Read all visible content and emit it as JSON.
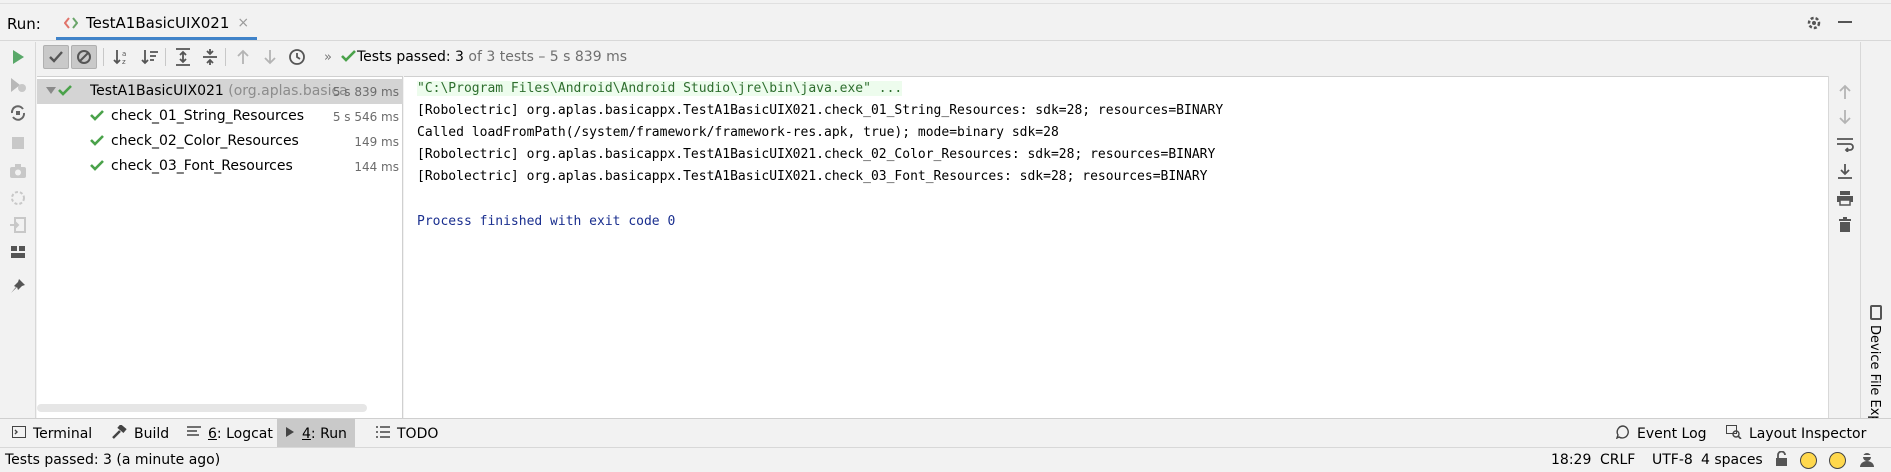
{
  "run_panel": {
    "label": "Run:",
    "tab_title": "TestA1BasicUIX021",
    "close_glyph": "×"
  },
  "status": {
    "prefix": "Tests passed: ",
    "count": "3",
    "suffix": " of 3 tests – 5 s 839 ms"
  },
  "tree": {
    "root": {
      "name": "TestA1BasicUIX021",
      "package": " (org.aplas.basica",
      "duration": "5 s 839 ms"
    },
    "tests": [
      {
        "name": "check_01_String_Resources",
        "duration": "5 s 546 ms"
      },
      {
        "name": "check_02_Color_Resources",
        "duration": "149 ms"
      },
      {
        "name": "check_03_Font_Resources",
        "duration": "144 ms"
      }
    ]
  },
  "console": {
    "command": "\"C:\\Program Files\\Android\\Android Studio\\jre\\bin\\java.exe\" ...",
    "lines": [
      "[Robolectric] org.aplas.basicappx.TestA1BasicUIX021.check_01_String_Resources: sdk=28; resources=BINARY",
      "Called loadFromPath(/system/framework/framework-res.apk, true); mode=binary sdk=28",
      "[Robolectric] org.aplas.basicappx.TestA1BasicUIX021.check_02_Color_Resources: sdk=28; resources=BINARY",
      "[Robolectric] org.aplas.basicappx.TestA1BasicUIX021.check_03_Font_Resources: sdk=28; resources=BINARY"
    ],
    "process": "Process finished with exit code 0"
  },
  "side_panel": {
    "label": "Device File Explorer"
  },
  "bottom_tabs": {
    "terminal": "Terminal",
    "build": "Build",
    "logcat_num": "6",
    "logcat_rest": ": Logcat",
    "run_num": "4",
    "run_rest": ": Run",
    "todo": "TODO",
    "event_log": "Event Log",
    "layout_inspector": "Layout Inspector"
  },
  "statusbar": {
    "message": "Tests passed: 3 (a minute ago)",
    "position": "18:29",
    "line_sep": "CRLF",
    "encoding": "UTF-8",
    "indent": "4 spaces"
  },
  "colors": {
    "pass_green": "#4aa24a",
    "run_green": "#59a869",
    "accent_blue": "#4083c9"
  }
}
